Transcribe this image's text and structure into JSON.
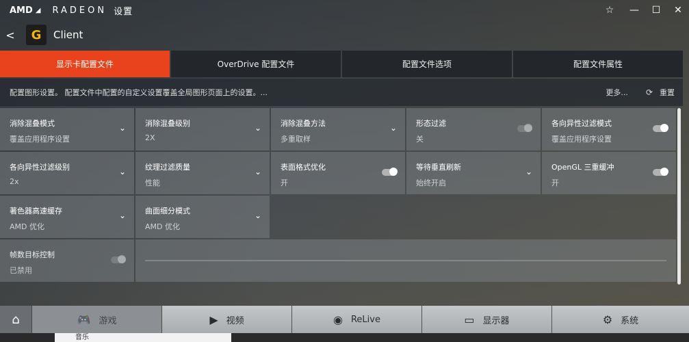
{
  "titlebar": {
    "brand_amd": "AMD",
    "brand_radeon": "RADEON",
    "brand_settings": "设置",
    "controls": [
      "☆",
      "—",
      "☐",
      "✕"
    ]
  },
  "appbar": {
    "back": "<",
    "game_icon_letter": "G",
    "title": "Client"
  },
  "tabs": [
    {
      "label": "显示卡配置文件",
      "active": true
    },
    {
      "label": "OverDrive 配置文件",
      "active": false
    },
    {
      "label": "配置文件选项",
      "active": false
    },
    {
      "label": "配置文件属性",
      "active": false
    }
  ],
  "descbar": {
    "text": "配置图形设置。 配置文件中配置的自定义设置覆盖全局图形页面上的设置。...",
    "more": "更多...",
    "reset": "重置"
  },
  "settings": [
    [
      {
        "label": "消除混叠模式",
        "value": "覆盖应用程序设置",
        "control": "dropdown"
      },
      {
        "label": "消除混叠级别",
        "value": "2X",
        "control": "dropdown"
      },
      {
        "label": "消除混叠方法",
        "value": "多重取样",
        "control": "dropdown"
      },
      {
        "label": "形态过滤",
        "value": "关",
        "control": "toggle-off"
      },
      {
        "label": "各向异性过滤模式",
        "value": "覆盖应用程序设置",
        "control": "toggle-on"
      }
    ],
    [
      {
        "label": "各向异性过滤级别",
        "value": "2x",
        "control": "dropdown"
      },
      {
        "label": "纹理过滤质量",
        "value": "性能",
        "control": "dropdown"
      },
      {
        "label": "表面格式优化",
        "value": "开",
        "control": "toggle-on"
      },
      {
        "label": "等待垂直刷新",
        "value": "始终开启",
        "control": "dropdown"
      },
      {
        "label": "OpenGL 三重缓冲",
        "value": "开",
        "control": "toggle-on"
      }
    ],
    [
      {
        "label": "著色器高速缓存",
        "value": "AMD 优化",
        "control": "dropdown"
      },
      {
        "label": "曲面细分模式",
        "value": "AMD 优化",
        "control": "dropdown"
      }
    ]
  ],
  "frame_target": {
    "label": "帧数目标控制",
    "value": "已禁用"
  },
  "bottomnav": [
    {
      "label": "游戏",
      "icon": "gamepad-icon",
      "glyph": "🎮",
      "active": true
    },
    {
      "label": "视频",
      "icon": "play-icon",
      "glyph": "▶",
      "active": false
    },
    {
      "label": "ReLive",
      "icon": "relive-icon",
      "glyph": "◉",
      "active": false
    },
    {
      "label": "显示器",
      "icon": "monitor-icon",
      "glyph": "▭",
      "active": false
    },
    {
      "label": "系统",
      "icon": "gear-icon",
      "glyph": "⚙",
      "active": false
    }
  ],
  "taskbar": {
    "label": "音乐"
  },
  "colors": {
    "accent": "#e8431d",
    "tab_bg": "#23272b",
    "nav_bg": "#b8bbbe"
  }
}
